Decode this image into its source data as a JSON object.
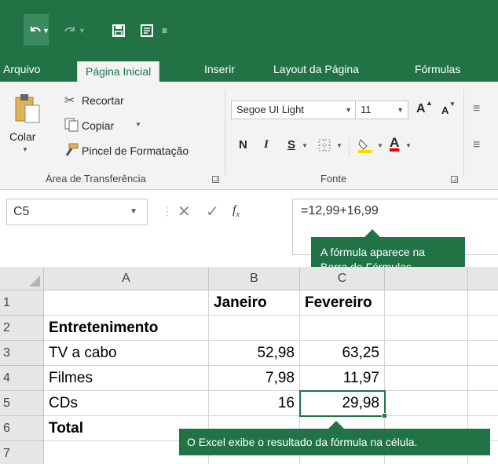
{
  "colors": {
    "accent": "#217346",
    "ribbon_bg": "#f3f3f3",
    "header_bg": "#e6e6e6"
  },
  "qat": {
    "icons": [
      "undo-icon",
      "redo-icon",
      "save-icon",
      "form-icon",
      "customize-qat-icon"
    ]
  },
  "tabs": [
    {
      "label": "Arquivo",
      "active": false
    },
    {
      "label": "Página Inicial",
      "active": true
    },
    {
      "label": "Inserir",
      "active": false
    },
    {
      "label": "Layout da Página",
      "active": false
    },
    {
      "label": "Fórmulas",
      "active": false
    }
  ],
  "ribbon": {
    "clipboard": {
      "paste_label": "Colar",
      "cut_label": "Recortar",
      "copy_label": "Copiar",
      "format_painter_label": "Pincel de Formatação",
      "group_label": "Área de Transferência"
    },
    "font": {
      "font_name": "Segoe UI Light",
      "font_size": "11",
      "bold": "N",
      "italic": "I",
      "underline": "S",
      "grow": "A",
      "shrink": "A",
      "group_label": "Fonte"
    }
  },
  "formula_bar": {
    "name_box": "C5",
    "formula": "=12,99+16,99"
  },
  "callouts": {
    "formula_bar_note": [
      "A fórmula aparece na",
      "Barra de Fórmulas."
    ],
    "cell_result_note": "O Excel exibe o resultado da fórmula na célula."
  },
  "sheet": {
    "columns": [
      "A",
      "B",
      "C"
    ],
    "rows": [
      {
        "num": "1",
        "a": "",
        "b": "Janeiro",
        "c": "Fevereiro"
      },
      {
        "num": "2",
        "a": "Entretenimento",
        "b": "",
        "c": ""
      },
      {
        "num": "3",
        "a": "TV a cabo",
        "b": "52,98",
        "c": "63,25"
      },
      {
        "num": "4",
        "a": "Filmes",
        "b": "7,98",
        "c": "11,97"
      },
      {
        "num": "5",
        "a": "CDs",
        "b": "16",
        "c": "29,98"
      },
      {
        "num": "6",
        "a": "Total",
        "b": "",
        "c": ""
      },
      {
        "num": "7",
        "a": "",
        "b": "",
        "c": ""
      }
    ]
  }
}
